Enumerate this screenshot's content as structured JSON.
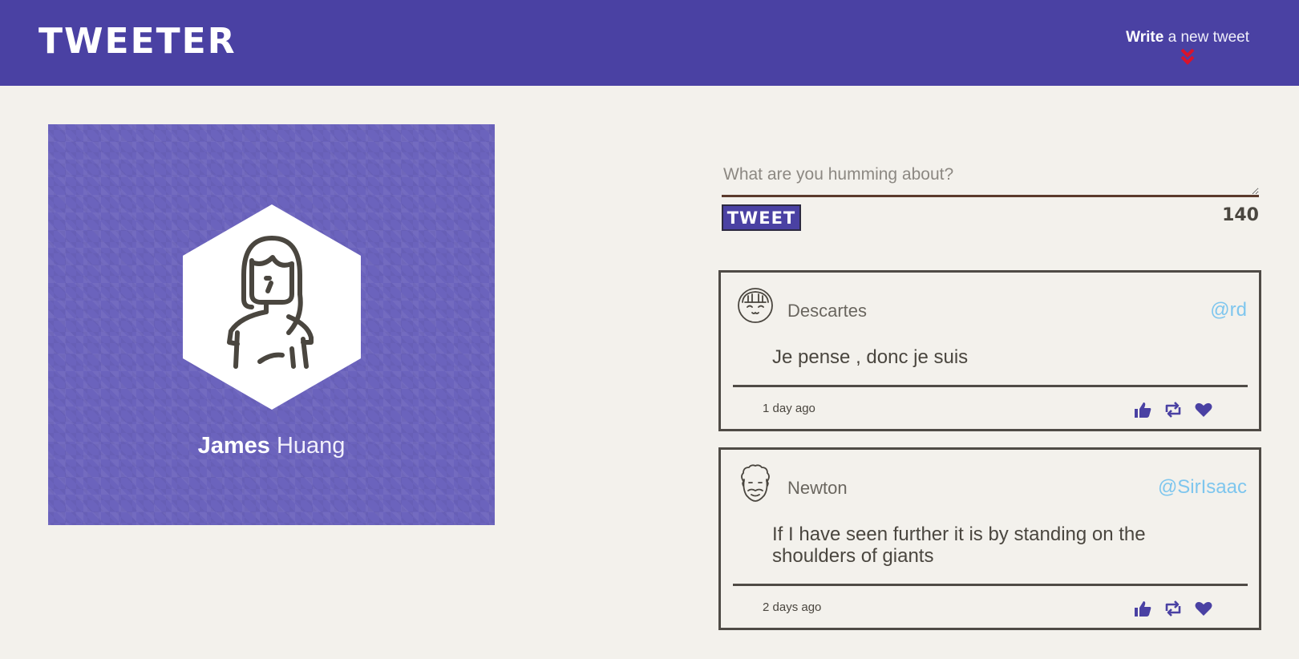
{
  "header": {
    "logo": "TWEETER",
    "compose_bold": "Write",
    "compose_rest": " a new tweet"
  },
  "profile": {
    "first_name": "James",
    "last_name": "Huang"
  },
  "compose": {
    "placeholder": "What are you humming about?",
    "button_label": "TWEET",
    "char_count": "140"
  },
  "tweets": [
    {
      "name": "Descartes",
      "handle": "@rd",
      "text": "Je pense , donc je suis",
      "time": "1 day ago"
    },
    {
      "name": "Newton",
      "handle": "@SirIsaac",
      "text": "If I have seen further it is by standing on the shoulders of giants",
      "time": "2 days ago"
    }
  ],
  "colors": {
    "brand": "#4a41a3",
    "handle": "#7ec6ee",
    "background": "#f3f1ec",
    "chevron": "#d9132b"
  }
}
